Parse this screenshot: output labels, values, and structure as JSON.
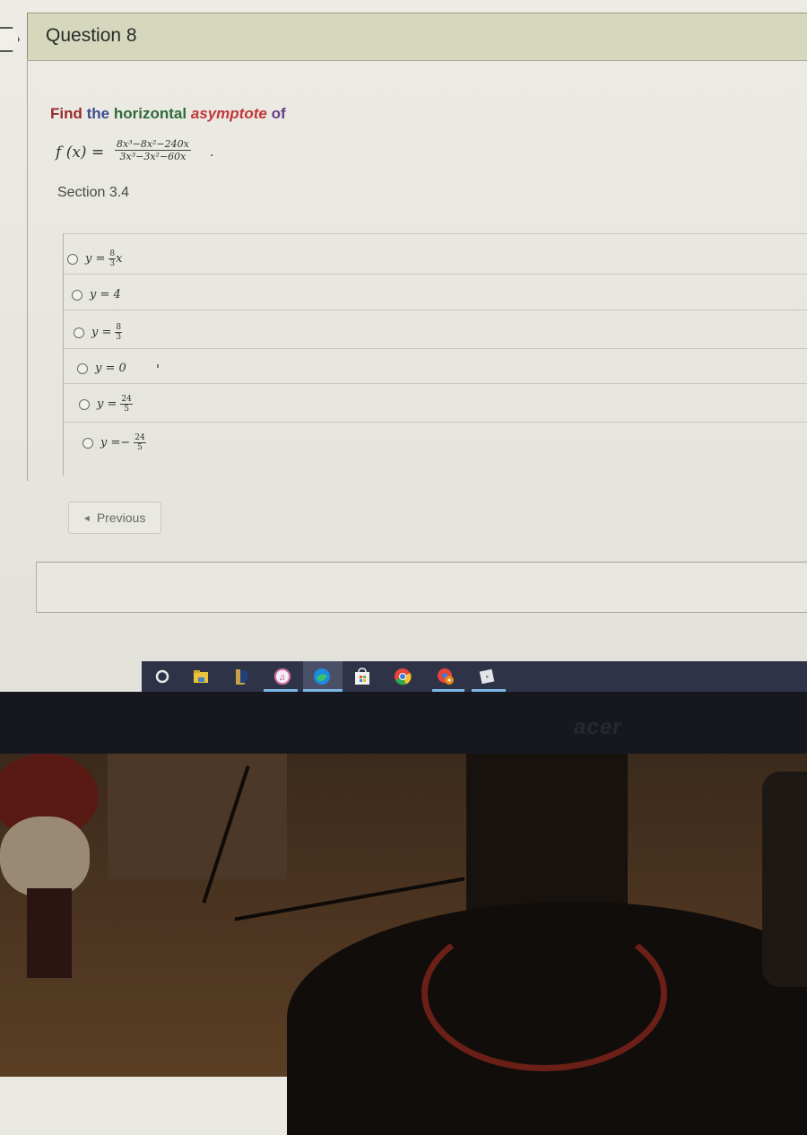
{
  "question": {
    "title": "Question 8",
    "prompt": {
      "w1": "Find",
      "w2": "the",
      "w3": "horizontal",
      "w4": "asymptote",
      "w5": "of"
    },
    "formula": {
      "lhs": "f (x) =",
      "numerator": "8x³−8x²−240x",
      "denominator": "3x³−3x²−60x",
      "trailing": "."
    },
    "section": "Section 3.4",
    "choices": [
      {
        "lhs": "y =",
        "num": "8",
        "den": "3",
        "suffix": "x",
        "sign": ""
      },
      {
        "lhs": "y = 4",
        "num": "",
        "den": "",
        "suffix": "",
        "sign": ""
      },
      {
        "lhs": "y =",
        "num": "8",
        "den": "3",
        "suffix": "",
        "sign": ""
      },
      {
        "lhs": "y = 0",
        "num": "",
        "den": "",
        "suffix": "",
        "sign": ""
      },
      {
        "lhs": "y =",
        "num": "24",
        "den": "5",
        "suffix": "",
        "sign": ""
      },
      {
        "lhs": "y =",
        "num": "24",
        "den": "5",
        "suffix": "",
        "sign": "−"
      }
    ]
  },
  "navigation": {
    "previous_label": "Previous",
    "previous_icon": "triangle-left-icon"
  },
  "taskbar": {
    "icons": [
      {
        "name": "cortana-icon"
      },
      {
        "name": "file-explorer-icon"
      },
      {
        "name": "league-of-legends-icon"
      },
      {
        "name": "itunes-icon",
        "running": true
      },
      {
        "name": "edge-icon",
        "running": true,
        "active": true
      },
      {
        "name": "microsoft-store-icon"
      },
      {
        "name": "chrome-icon"
      },
      {
        "name": "chrome-profile-icon",
        "running": true
      },
      {
        "name": "roblox-icon",
        "running": true
      }
    ]
  },
  "monitor": {
    "brand": "acer"
  },
  "colors": {
    "header_bg": "#d6d8bd",
    "taskbar_bg": "#2e3347",
    "running_indicator": "#7bb6e6"
  }
}
